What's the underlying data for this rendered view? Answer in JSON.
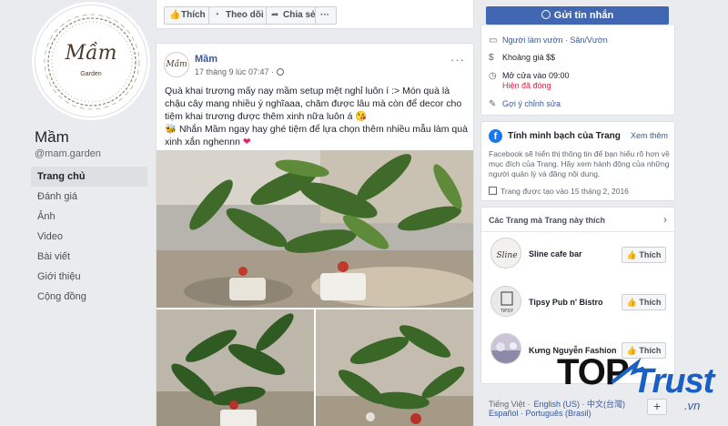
{
  "page": {
    "logo_brand": "Mầm",
    "logo_sub": "Garden",
    "name": "Mầm",
    "handle": "@mam.garden"
  },
  "nav": {
    "items": [
      {
        "label": "Trang chủ",
        "active": true
      },
      {
        "label": "Đánh giá"
      },
      {
        "label": "Ảnh"
      },
      {
        "label": "Video"
      },
      {
        "label": "Bài viết"
      },
      {
        "label": "Giới thiệu"
      },
      {
        "label": "Cộng đồng"
      }
    ]
  },
  "actionbar": {
    "like": "Thích",
    "follow": "Theo dõi",
    "share": "Chia sẻ",
    "more": "···"
  },
  "post": {
    "avatar_text": "Mầm",
    "author": "Mầm",
    "time": "17 tháng 9 lúc 07:47 ·",
    "more": "···",
    "text_1": "Quà khai trương mấy nay mầm setup mệt nghỉ luôn í :> Món quà là chậu cây mang nhiều ý nghĩaaa, chăm được lâu mà còn để decor cho tiệm khai trương được thêm xinh nữa luôn á 😘",
    "text_2": "🐝 Nhắn Mầm ngay hay ghé tiệm để lựa chọn thêm nhiều mẫu làm quà xinh xắn nghennn",
    "heart": "❤"
  },
  "sidebar_right": {
    "send_message": "Gửi tin nhắn",
    "category": "Người làm vườn · Sân/Vườn",
    "price": "Khoảng giá $$",
    "hours": "Mở cửa vào 09:00",
    "status": "Hiện đã đóng",
    "suggest": "Gợi ý chỉnh sửa"
  },
  "transparency": {
    "title": "Tính minh bạch của Trang",
    "more": "Xem thêm",
    "desc": "Facebook sẽ hiển thị thông tin để bạn hiểu rõ hơn về mục đích của Trang. Hãy xem hành động của những người quản lý và đăng nội dung.",
    "created": "Trang được tạo vào 15 tháng 2, 2016"
  },
  "liked_pages": {
    "header": "Các Trang mà Trang này thích",
    "items": [
      {
        "name": "Sline cafe bar",
        "avatar_text": "Sline",
        "button": "Thích"
      },
      {
        "name": "Tipsy Pub n' Bistro",
        "avatar_text": "TIPSY",
        "button": "Thích"
      },
      {
        "name": "Kưng Nguyễn Fashion",
        "avatar_text": "",
        "button": "Thích"
      }
    ]
  },
  "languages": {
    "current": "Tiếng Việt ·",
    "english": "English (US) · 中文(台灣)",
    "line2": "Español · Português (Brasil)",
    "plus": "+"
  },
  "watermark": {
    "top": "TOP",
    "trust": "Trust",
    "vn": ".vn"
  },
  "colors": {
    "fb_blue": "#4267b2",
    "link": "#385898",
    "closed": "#e41e3f",
    "heart": "#e0245e"
  }
}
